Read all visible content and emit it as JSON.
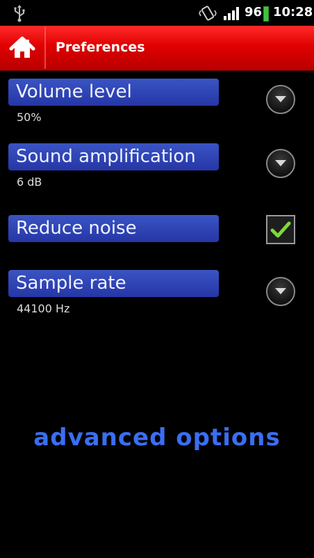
{
  "status_bar": {
    "usb_icon": "usb-icon",
    "vibrate_icon": "vibrate-icon",
    "signal_icon": "signal-icon",
    "battery_level": "96",
    "battery_color": "#3ec43e",
    "time": "10:28"
  },
  "action_bar": {
    "home_icon": "home-icon",
    "title": "Preferences",
    "color": "#e00000"
  },
  "preferences": [
    {
      "label": "Volume level",
      "summary": "50%",
      "control": "dropdown"
    },
    {
      "label": "Sound amplification",
      "summary": "6 dB",
      "control": "dropdown"
    },
    {
      "label": "Reduce noise",
      "summary": "",
      "control": "checkbox",
      "checked": true
    },
    {
      "label": "Sample rate",
      "summary": "44100 Hz",
      "control": "dropdown"
    }
  ],
  "advanced_link": "advanced options",
  "colors": {
    "label_background": "#2e44b4",
    "link": "#3a6ef2",
    "check": "#7fd83a"
  }
}
